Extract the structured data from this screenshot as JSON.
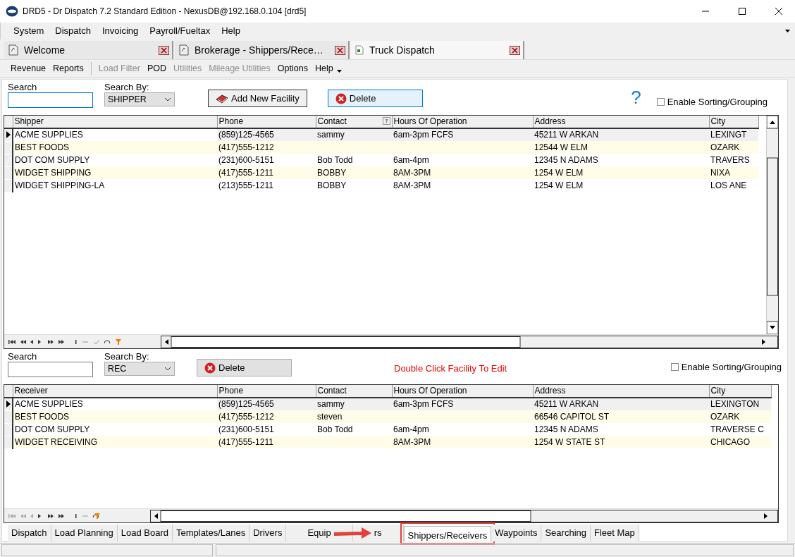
{
  "window": {
    "title": "DRD5 - Dr Dispatch 7.2 Standard Edition - NexusDB@192.168.0.104 [drd5]"
  },
  "menu": [
    "System",
    "Dispatch",
    "Invoicing",
    "Payroll/Fueltax",
    "Help"
  ],
  "doc_tabs": [
    {
      "label": "Welcome",
      "selected": false
    },
    {
      "label": "Brokerage - Shippers/Rece…",
      "selected": false
    },
    {
      "label": "Truck Dispatch",
      "selected": true
    }
  ],
  "toolbar": [
    {
      "label": "Revenue",
      "disabled": false
    },
    {
      "label": "Reports",
      "disabled": false
    },
    {
      "label": "Load Filter",
      "disabled": true
    },
    {
      "label": "POD",
      "disabled": false
    },
    {
      "label": "Utilities",
      "disabled": true
    },
    {
      "label": "Mileage Utilities",
      "disabled": true
    },
    {
      "label": "Options",
      "disabled": false
    },
    {
      "label": "Help",
      "disabled": false
    }
  ],
  "shippers": {
    "search_label": "Search",
    "search_by_label": "Search By:",
    "search_by_value": "SHIPPER",
    "buttons": [
      {
        "label": "Add New Facility",
        "kind": "add",
        "highlighted": false
      },
      {
        "label": "Delete",
        "kind": "delete",
        "highlighted": true
      }
    ],
    "help": "?",
    "sorting": {
      "label": "Enable Sorting/Grouping",
      "checked": false
    },
    "columns": [
      "Shipper",
      "Phone",
      "Contact",
      "Hours Of Operation",
      "Address",
      "City"
    ],
    "rows": [
      {
        "cells": [
          "ACME SUPPLIES",
          "(859)125-4565",
          "sammy",
          "6am-3pm FCFS",
          "45211 W ARKAN",
          "LEXINGT"
        ],
        "selected": true
      },
      {
        "cells": [
          "BEST FOODS",
          "(417)555-1212",
          "",
          "",
          "12544 W ELM",
          "OZARK"
        ],
        "selected": false
      },
      {
        "cells": [
          "DOT COM SUPPLY",
          "(231)600-5151",
          "Bob Todd",
          "6am-4pm",
          "12345 N ADAMS",
          "TRAVERS"
        ],
        "selected": false
      },
      {
        "cells": [
          "WIDGET SHIPPING",
          "(417)555-1211",
          "BOBBY",
          "8AM-3PM",
          "1254 W ELM",
          "NIXA"
        ],
        "selected": false
      },
      {
        "cells": [
          "WIDGET SHIPPING-LA",
          "(213)555-1211",
          "BOBBY",
          "8AM-3PM",
          "1254 W ELM",
          "LOS ANE"
        ],
        "selected": false
      }
    ]
  },
  "receivers": {
    "search_label": "Search",
    "search_by_label": "Search By:",
    "search_by_value": "REC",
    "buttons": [
      {
        "label": "Delete",
        "kind": "delete",
        "highlighted": false
      }
    ],
    "hint": "Double Click Facility To Edit",
    "sorting": {
      "label": "Enable Sorting/Grouping",
      "checked": false
    },
    "columns": [
      "Receiver",
      "Phone",
      "Contact",
      "Hours Of Operation",
      "Address",
      "City"
    ],
    "rows": [
      {
        "cells": [
          "ACME SUPPLIES",
          "(859)125-4565",
          "sammy",
          "6am-3pm FCFS",
          "45211 W ARKAN",
          "LEXINGTON"
        ],
        "selected": true
      },
      {
        "cells": [
          "BEST FOODS",
          "(417)555-1212",
          "steven",
          "",
          "66546 CAPITOL ST",
          "OZARK"
        ],
        "selected": false
      },
      {
        "cells": [
          "DOT COM SUPPLY",
          "(231)600-5151",
          "Bob Todd",
          "6am-4pm",
          "12345 N ADAMS",
          "TRAVERSE C"
        ],
        "selected": false
      },
      {
        "cells": [
          "WIDGET RECEIVING",
          "(417)555-1211",
          "",
          "8AM-3PM",
          "1254 W STATE ST",
          "CHICAGO"
        ],
        "selected": false
      }
    ]
  },
  "bottom_tabs": [
    {
      "label": "Dispatch",
      "selected": false
    },
    {
      "label": "Load Planning",
      "selected": false
    },
    {
      "label": "Load Board",
      "selected": false
    },
    {
      "label": "Templates/Lanes",
      "selected": false
    },
    {
      "label": "Drivers",
      "selected": false
    },
    {
      "label": "Equip",
      "selected": false,
      "covered": true
    },
    {
      "label": "rs",
      "selected": false,
      "covered": true
    },
    {
      "label": "Shippers/Receivers",
      "selected": true,
      "highlighted": true
    },
    {
      "label": "Waypoints",
      "selected": false
    },
    {
      "label": "Searching",
      "selected": false
    },
    {
      "label": "Fleet Map",
      "selected": false
    }
  ]
}
